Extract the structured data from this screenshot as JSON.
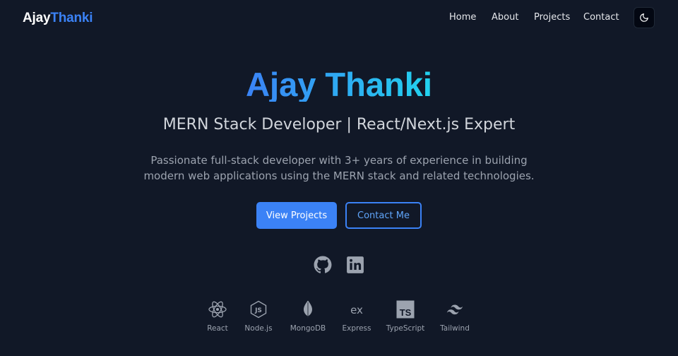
{
  "nav": {
    "brand_first": "Ajay",
    "brand_second": "Thanki",
    "links": [
      "Home",
      "About",
      "Projects",
      "Contact"
    ],
    "theme_toggle_icon": "moon-icon"
  },
  "hero": {
    "title": "Ajay Thanki",
    "subtitle": "MERN Stack Developer | React/Next.js Expert",
    "description": "Passionate full-stack developer with 3+ years of experience in building modern web applications using the MERN stack and related technologies.",
    "primary_button": "View Projects",
    "secondary_button": "Contact Me"
  },
  "social": [
    {
      "icon": "github-icon"
    },
    {
      "icon": "linkedin-icon"
    }
  ],
  "tech_stack": [
    {
      "label": "React",
      "icon": "react-icon"
    },
    {
      "label": "Node.js",
      "icon": "nodejs-icon"
    },
    {
      "label": "MongoDB",
      "icon": "mongodb-icon"
    },
    {
      "label": "Express",
      "icon": "express-icon"
    },
    {
      "label": "TypeScript",
      "icon": "typescript-icon"
    },
    {
      "label": "Tailwind",
      "icon": "tailwind-icon"
    }
  ],
  "colors": {
    "background": "#111827",
    "accent": "#3b82f6",
    "gradient_end": "#22d3ee",
    "muted_text": "#9ca3af"
  }
}
